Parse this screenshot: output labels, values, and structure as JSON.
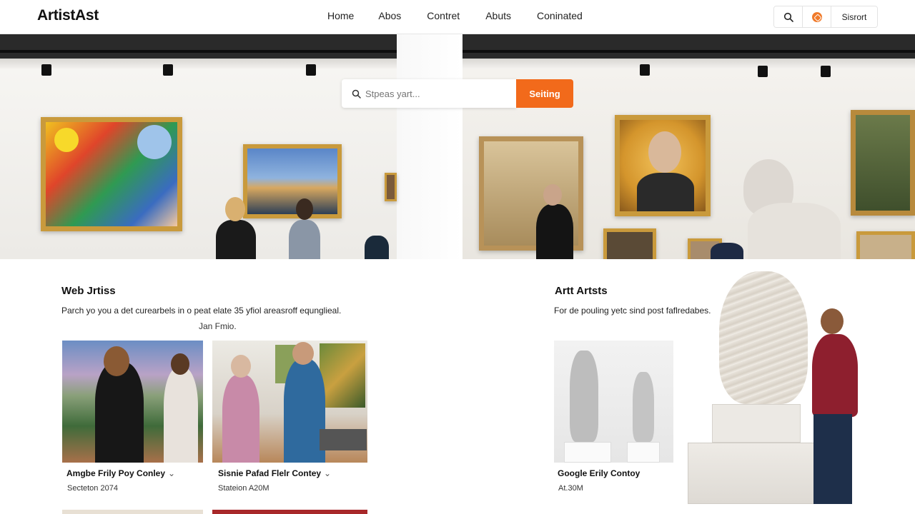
{
  "header": {
    "logo": "ArtistAst",
    "nav": [
      "Home",
      "Abos",
      "Contret",
      "Abuts",
      "Coninated"
    ],
    "sign_in": "Sisrort",
    "icons": [
      "search-icon",
      "brand-badge-icon"
    ],
    "accent_color": "#f26a1b"
  },
  "hero": {
    "search_placeholder": "Stpeas yart...",
    "search_button": "Seiting"
  },
  "left_section": {
    "title": "Web Jrtiss",
    "description": "Parch yo you a det curearbels in o peat elate 35 yfiol areasroff equnglieal.",
    "subtext": "Jan Fmio.",
    "cards": [
      {
        "title": "Amgbe Frily Poy Conley",
        "meta": "Secteton 2074"
      },
      {
        "title": "Sisnie Pafad Flelr Contey",
        "meta": "Stateion A20M"
      }
    ]
  },
  "right_section": {
    "title": "Artt Artsts",
    "description": "For de pouling yetc sind post faflredabes.",
    "cards": [
      {
        "title": "Google Erily Contoy",
        "meta": "At.30M"
      }
    ]
  }
}
